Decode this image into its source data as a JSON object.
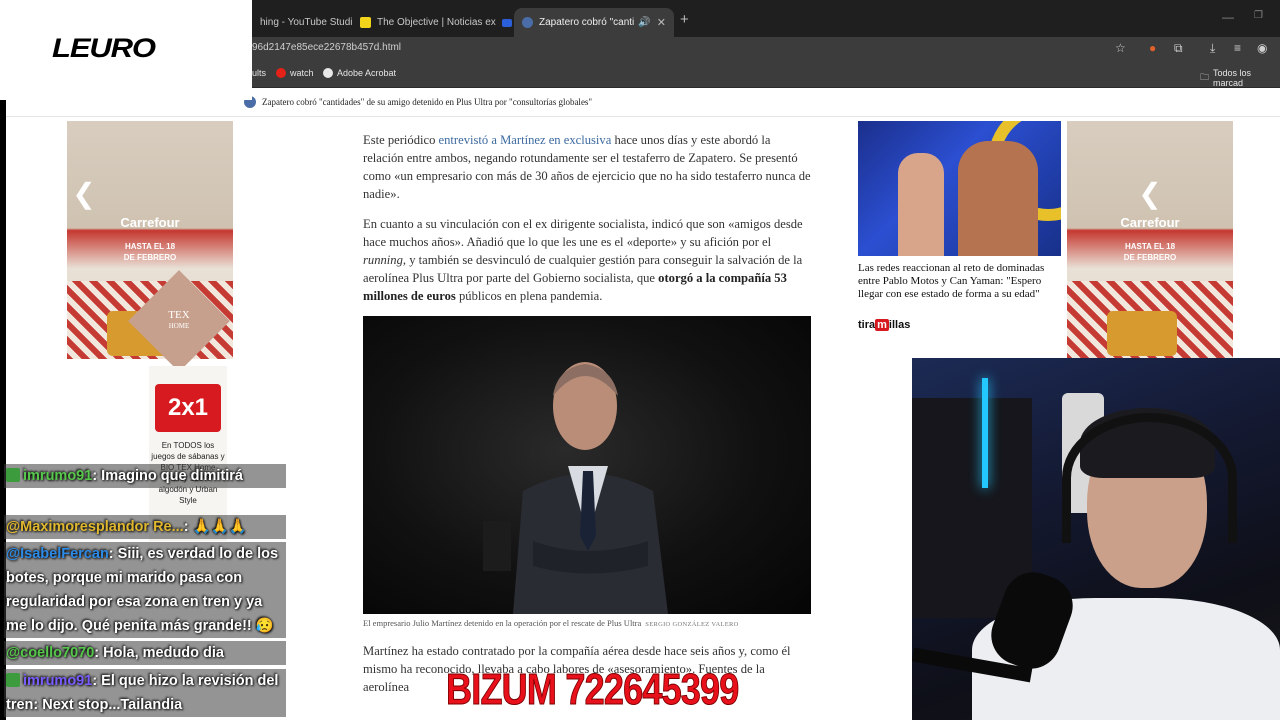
{
  "overlay": {
    "logo_text": "LEURO",
    "donation_banner": "BIZUM 722645399"
  },
  "browser": {
    "tabs": [
      {
        "label": "hing - YouTube Studio",
        "active": false
      },
      {
        "label": "The Objective | Noticias ex",
        "active": false
      },
      {
        "label": "Zapatero cobró \"cantidades",
        "active": true
      }
    ],
    "url": "96d2147e85ece22678b457d.html",
    "bookmarks": [
      "ults",
      "watch",
      "Adobe Acrobat"
    ],
    "bookmarks_right": "Todos los marcad"
  },
  "article": {
    "breadcrumb": "Zapatero cobró \"cantidades\" de su amigo detenido en Plus Ultra por \"consultorías globales\"",
    "p1_before": "Este periódico ",
    "p1_link": "entrevistó a Martínez en exclusiva",
    "p1_after": " hace unos días y este abordó la relación entre ambos, negando rotundamente ser el testaferro de Zapatero. Se presentó como «un empresario con más de 30 años de ejercicio que no ha sido testaferro nunca de nadie».",
    "p2_a": "En cuanto a su vinculación con el ex dirigente socialista, indicó que son «amigos desde hace muchos años». Añadió que lo que les une es el «deporte» y su afición por el ",
    "p2_italic": "running",
    "p2_b": ", y también se desvinculó de cualquier gestión para conseguir la salvación de la aerolínea Plus Ultra por parte del Gobierno socialista, que ",
    "p2_bold": "otorgó a la compañía 53 millones de euros",
    "p2_c": " públicos en plena pandemia.",
    "caption": "El empresario Julio Martínez detenido en la operación por el rescate de Plus Ultra",
    "caption_credit": "SERGIO GONZÁLEZ VALERO",
    "p3": "Martínez ha estado contratado por la compañía aérea desde hace seis años y, como él mismo ha reconocido, llevaba a cabo labores de «asesoramiento». Fuentes de la aerolínea"
  },
  "ads": {
    "brand": "Carrefour",
    "promo_line1": "HASTA EL 18",
    "promo_line2": "DE FEBRERO",
    "tex_line1": "TEX",
    "tex_line2": "HOME",
    "offer": "2x1",
    "offer_copy": "En TODOS los juegos de sábanas y BIO TEX Home Fancy 100% algodón y Urban Style"
  },
  "related": {
    "title": "Las redes reaccionan al reto de dominadas entre Pablo Motos y Can Yaman: \"Espero llegar con ese estado de forma a su edad\"",
    "source_a": "tira",
    "source_m": "m",
    "source_b": "illas"
  },
  "chat": [
    {
      "user": "imrumo91",
      "text": ": Imagino que dimitirá",
      "color": "green",
      "badge": true
    },
    {
      "user": "@Maximoresplandor Re...",
      "text": ": 🙏🙏🙏",
      "color": "gold",
      "badge": false
    },
    {
      "user": "@IsabelFercan",
      "text": ": Siii, es verdad lo de los botes, porque mi marido pasa con regularidad por esa zona en tren y ya me lo dijo. Qué penita más grande!! 😥",
      "color": "blue",
      "badge": false
    },
    {
      "user": "@coello7070",
      "text": ": Hola, medudo dia",
      "color": "green",
      "badge": false
    },
    {
      "user": "imrumo91",
      "text": ": El que hizo la revisión del tren: Next stop...Tailandia",
      "color": "purple",
      "badge": true
    }
  ]
}
